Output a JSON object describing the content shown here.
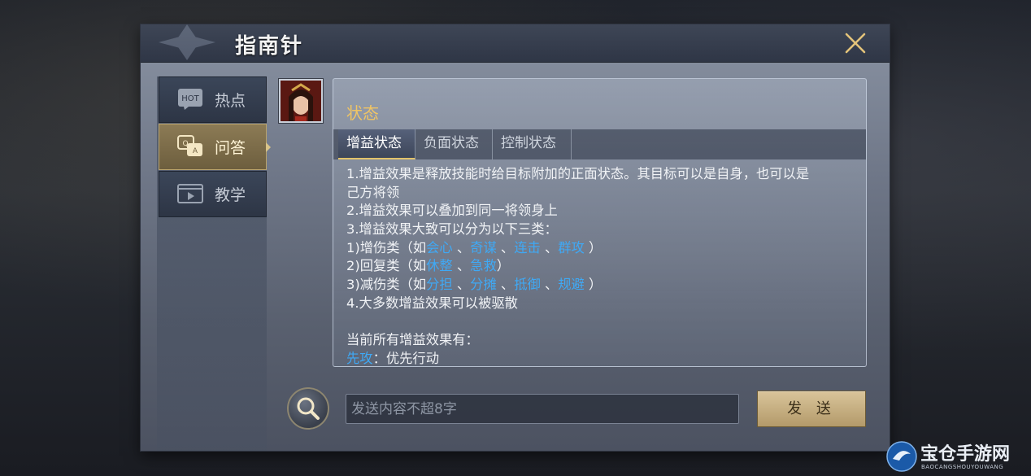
{
  "dialog": {
    "title": "指南针",
    "close_icon": "close-icon"
  },
  "sidebar": {
    "items": [
      {
        "icon": "hot-icon",
        "icon_text": "HOT",
        "label": "热点",
        "active": false
      },
      {
        "icon": "qa-icon",
        "label": "问答",
        "active": true
      },
      {
        "icon": "video-icon",
        "label": "教学",
        "active": false
      }
    ]
  },
  "content": {
    "heading": "状态",
    "tabs": [
      {
        "label": "增益状态",
        "active": true
      },
      {
        "label": "负面状态",
        "active": false
      },
      {
        "label": "控制状态",
        "active": false
      }
    ],
    "lines": [
      [
        {
          "t": "1.增益效果是释放技能时给目标附加的正面状态。其目标可以是自身，也可以是"
        }
      ],
      [
        {
          "t": "己方将领"
        }
      ],
      [
        {
          "t": "2.增益效果可以叠加到同一将领身上"
        }
      ],
      [
        {
          "t": "3.增益效果大致可以分为以下三类："
        }
      ],
      [
        {
          "t": "1)增伤类（如"
        },
        {
          "t": "会心",
          "k": 1
        },
        {
          "t": " 、"
        },
        {
          "t": "奇谋",
          "k": 1
        },
        {
          "t": " 、"
        },
        {
          "t": "连击",
          "k": 1
        },
        {
          "t": " 、"
        },
        {
          "t": "群攻",
          "k": 1
        },
        {
          "t": " ）"
        }
      ],
      [
        {
          "t": "2)回复类（如"
        },
        {
          "t": "休整",
          "k": 1
        },
        {
          "t": " 、"
        },
        {
          "t": "急救",
          "k": 1
        },
        {
          "t": "）"
        }
      ],
      [
        {
          "t": "3)减伤类（如"
        },
        {
          "t": "分担",
          "k": 1
        },
        {
          "t": " 、"
        },
        {
          "t": "分摊",
          "k": 1
        },
        {
          "t": "  、"
        },
        {
          "t": "抵御",
          "k": 1
        },
        {
          "t": " 、"
        },
        {
          "t": "规避",
          "k": 1
        },
        {
          "t": "  ）"
        }
      ],
      [
        {
          "t": "4.大多数增益效果可以被驱散"
        }
      ],
      [
        {
          "t": ""
        }
      ],
      [
        {
          "t": "当前所有增益效果有："
        }
      ],
      [
        {
          "t": "先攻",
          "k": 1
        },
        {
          "t": "：优先行动"
        }
      ]
    ]
  },
  "chat": {
    "search_icon": "search-icon",
    "placeholder": "发送内容不超8字",
    "value": "",
    "send_label": "发 送"
  },
  "watermark": {
    "text": "宝仓手游网",
    "sub": "BAOCANGSHOUYOUWANG"
  },
  "colors": {
    "accent_gold": "#f0c564",
    "keyword_blue": "#3fa9f5",
    "active_tab_gold": "#b9a36c"
  }
}
